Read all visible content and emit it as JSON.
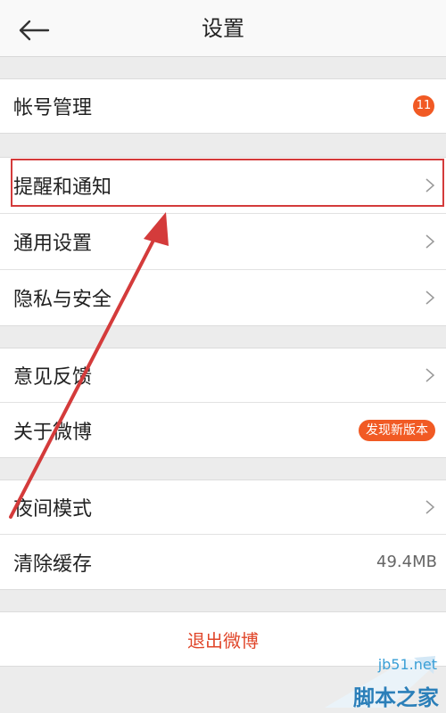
{
  "header": {
    "title": "设置",
    "back_icon": "back-arrow-icon"
  },
  "groups": [
    {
      "items": [
        {
          "label": "帐号管理",
          "badge": "11"
        }
      ]
    },
    {
      "items": [
        {
          "label": "提醒和通知",
          "highlighted": true
        },
        {
          "label": "通用设置"
        },
        {
          "label": "隐私与安全"
        }
      ]
    },
    {
      "items": [
        {
          "label": "意见反馈"
        },
        {
          "label": "关于微博",
          "tag": "发现新版本"
        }
      ]
    },
    {
      "items": [
        {
          "label": "夜间模式"
        },
        {
          "label": "清除缓存",
          "value": "49.4MB"
        }
      ]
    }
  ],
  "logout": {
    "label": "退出微博"
  },
  "annotation": {
    "color": "#d43b3b"
  },
  "watermark": {
    "url": "jb51.net",
    "text": "脚本之家"
  },
  "colors": {
    "accent": "#f15a24",
    "logout_text": "#e0462a"
  }
}
